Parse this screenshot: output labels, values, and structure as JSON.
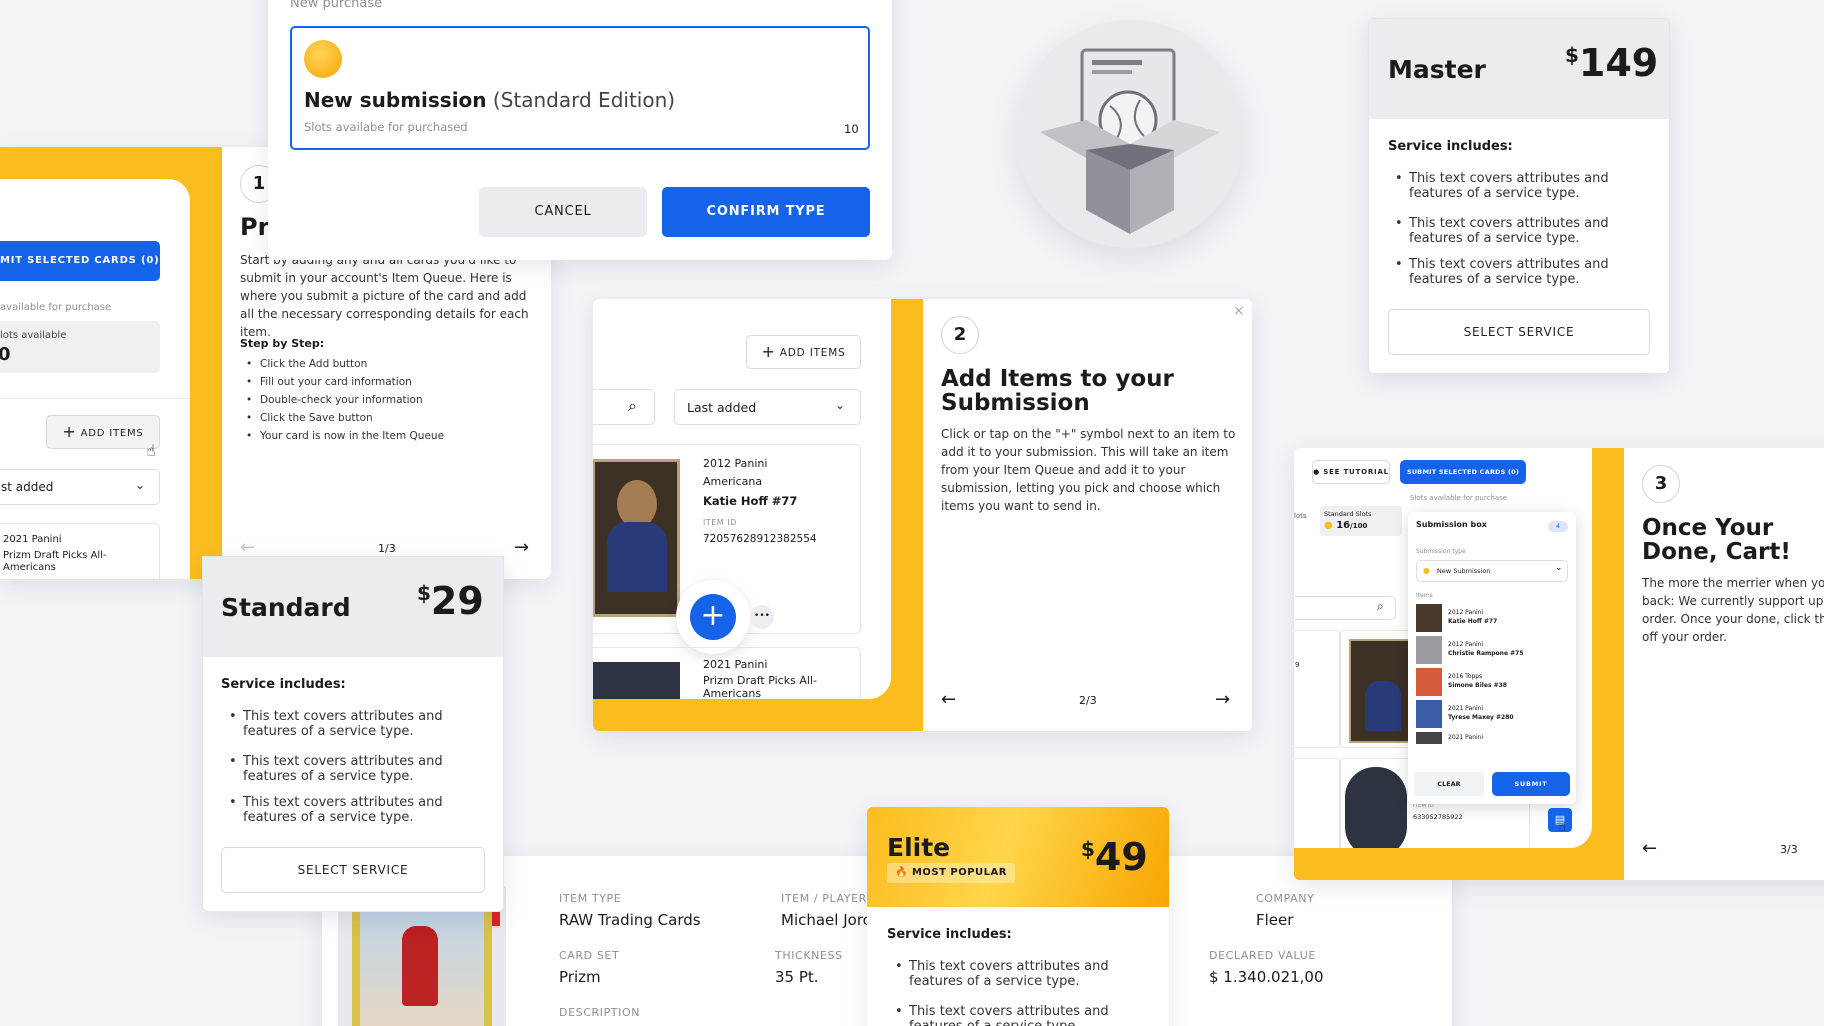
{
  "purchase_modal": {
    "header": "New purchase",
    "title_bold": "New submission",
    "title_light": "(Standard Edition)",
    "subtitle": "Slots availabe for purchased",
    "count": "10",
    "cancel_label": "CANCEL",
    "confirm_label": "CONFIRM TYPE"
  },
  "step1": {
    "number": "1",
    "title": "Pr",
    "body": "Start by adding any and all cards you'd like to submit in your account's Item Queue. Here is where you submit a picture of the card and add all the necessary corresponding details for each item.",
    "steps_heading": "Step by Step:",
    "steps": [
      "Click the Add button",
      "Fill out your card information",
      "Double-check your information",
      "Click the Save button",
      "Your card is now in the Item Queue"
    ],
    "pager": "1/3",
    "submit_label": "MIT SELECTED CARDS (0)",
    "available_label": "available for purchase",
    "slots_label": "lots available",
    "slots_value": "0",
    "add_items_label": "ADD ITEMS",
    "sort_label": "st added",
    "item_line1": "2021 Panini",
    "item_line2": "Prizm Draft Picks All-Americans"
  },
  "step2": {
    "number": "2",
    "title": "Add Items to your Submission",
    "body": "Click or tap on the \"+\" symbol next to an item to add it to your submission. This will take an item from your Item Queue and add it to your submission, letting you pick and choose which items you want to send in.",
    "pager": "2/3",
    "add_items_label": "ADD ITEMS",
    "sort_label": "Last added",
    "item1": {
      "line1": "2012 Panini",
      "line2": "Americana",
      "name": "Katie Hoff #77",
      "id_label": "ITEM ID",
      "id_value": "72057628912382554"
    },
    "item2": {
      "line1": "2021 Panini",
      "line2": "Prizm Draft Picks All-Americans"
    }
  },
  "step3": {
    "number": "3",
    "title": "Once Your Done, Cart!",
    "body": "The more the merrier when you back: We currently support up to order. Once your done, click the off your order.",
    "pager": "3/3",
    "tutorial_label": "SEE TUTORIAL",
    "submit_label": "SUBMIT SELECTED CARDS (0)",
    "slots_available": "Slots available for purchase",
    "slots_label": "lots",
    "standard_slots_label": "Standard Slots",
    "standard_slots_value": "16",
    "standard_slots_total": "/100",
    "box_title": "Submission box",
    "box_count": "4",
    "type_label": "Submission type",
    "type_value": "New Submission",
    "items_label": "Items",
    "items": [
      {
        "set": "2012 Panini",
        "name": "Katie Hoff #77"
      },
      {
        "set": "2012 Panini",
        "name": "Christie Rampone #75"
      },
      {
        "set": "2016 Topps",
        "name": "Simone Biles #38"
      },
      {
        "set": "2021 Panini",
        "name": "Tyrese Maxey #280"
      },
      {
        "set": "2021 Panini",
        "name": ""
      }
    ],
    "clear_label": "CLEAR",
    "submit_box_label": "SUBMIT",
    "side_text": "9",
    "item_id_label": "ITEM ID",
    "item_id_value": "633052785922"
  },
  "tiers": {
    "master": {
      "name": "Master",
      "currency": "$",
      "price": "149"
    },
    "standard": {
      "name": "Standard",
      "currency": "$",
      "price": "29"
    },
    "elite": {
      "name": "Elite",
      "currency": "$",
      "price": "49",
      "badge": "MOST POPULAR"
    },
    "includes_label": "Service includes:",
    "feature_text": "This text covers attributes and features of a service type.",
    "select_label": "SELECT SERVICE"
  },
  "item_detail": {
    "item_type_label": "ITEM TYPE",
    "item_type_value": "RAW Trading Cards",
    "player_label": "ITEM / PLAYER",
    "player_value": "Michael Jorc",
    "company_label": "COMPANY",
    "company_value": "Fleer",
    "card_set_label": "CARD SET",
    "card_set_value": "Prizm",
    "thickness_label": "THICKNESS",
    "thickness_value": "35 Pt.",
    "declared_label": "DECLARED VALUE",
    "declared_value": "$ 1.340.021,00",
    "description_label": "DESCRIPTION",
    "more_label": "•••"
  },
  "colors": {
    "accent_blue": "#1463e8",
    "gold": "#fbbd1e",
    "elite_gradient_start": "#fbbd1e",
    "elite_gradient_end": "#f7a600"
  }
}
